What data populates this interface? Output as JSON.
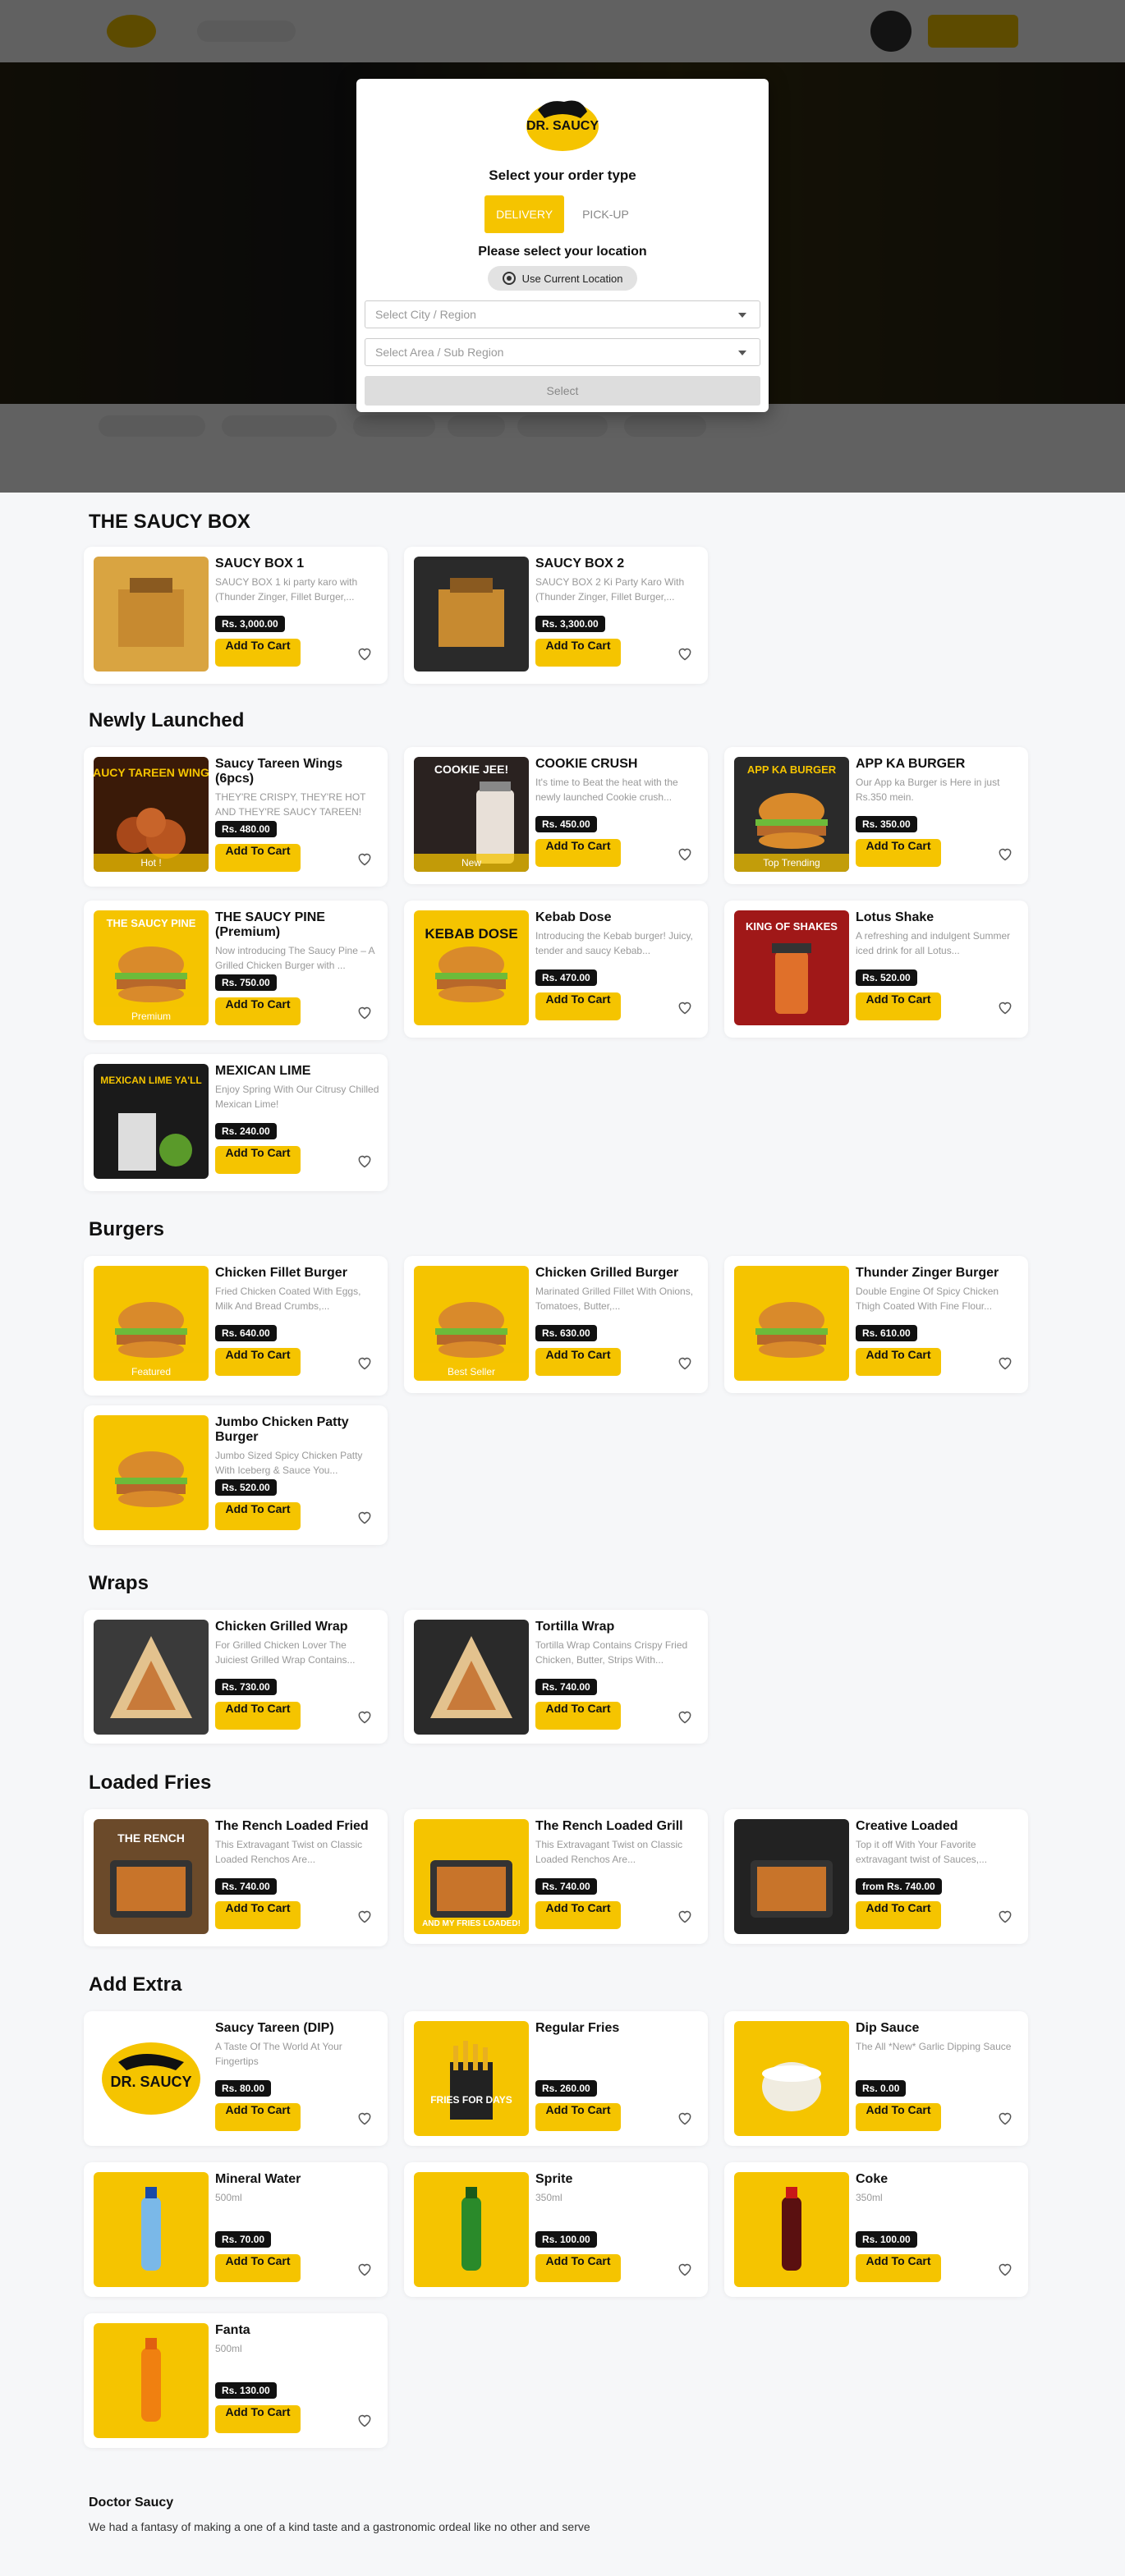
{
  "modal": {
    "title": "Select your order type",
    "delivery": "DELIVERY",
    "pickup": "PICK-UP",
    "location_title": "Please select your location",
    "current_location": "Use Current Location",
    "city_placeholder": "Select City / Region",
    "area_placeholder": "Select Area / Sub Region",
    "select_button": "Select",
    "logo_text": "DR. SAUCY"
  },
  "sections": [
    {
      "title": "THE SAUCY BOX"
    },
    {
      "title": "Newly Launched"
    },
    {
      "title": "Burgers"
    },
    {
      "title": "Wraps"
    },
    {
      "title": "Loaded Fries"
    },
    {
      "title": "Add Extra"
    }
  ],
  "add_to_cart": "Add To Cart",
  "products": [
    {
      "name": "SAUCY BOX 1",
      "desc": "SAUCY BOX 1 ki party karo with (Thunder Zinger, Fillet Burger,...",
      "price": "Rs. 3,000.00"
    },
    {
      "name": "SAUCY BOX 2",
      "desc": "SAUCY BOX 2 Ki Party Karo With (Thunder Zinger, Fillet Burger,...",
      "price": "Rs. 3,300.00"
    },
    {
      "name": "Saucy Tareen Wings (6pcs)",
      "desc": "THEY'RE CRISPY, THEY'RE HOT AND THEY'RE SAUCY TAREEN!",
      "price": "Rs. 480.00",
      "badge": "Hot !"
    },
    {
      "name": "COOKIE CRUSH",
      "desc": "It's time to Beat the heat with the newly launched Cookie crush...",
      "price": "Rs. 450.00",
      "badge": "New"
    },
    {
      "name": "APP KA BURGER",
      "desc": "Our App ka Burger is Here in just Rs.350 mein.",
      "price": "Rs. 350.00",
      "badge": "Top Trending"
    },
    {
      "name": "THE SAUCY PINE (Premium)",
      "desc": "Now introducing The Saucy Pine – A Grilled Chicken Burger with ...",
      "price": "Rs. 750.00",
      "badge": "Premium"
    },
    {
      "name": "Kebab Dose",
      "desc": "Introducing the Kebab burger! Juicy, tender and saucy Kebab...",
      "price": "Rs. 470.00"
    },
    {
      "name": "Lotus Shake",
      "desc": "A refreshing and indulgent Summer iced drink for all Lotus...",
      "price": "Rs. 520.00"
    },
    {
      "name": "MEXICAN LIME",
      "desc": "Enjoy Spring With Our Citrusy Chilled Mexican Lime!",
      "price": "Rs. 240.00"
    },
    {
      "name": "Chicken Fillet Burger",
      "desc": "Fried Chicken Coated With Eggs, Milk And Bread Crumbs,...",
      "price": "Rs. 640.00",
      "badge": "Featured"
    },
    {
      "name": "Chicken Grilled Burger",
      "desc": "Marinated Grilled Fillet With Onions, Tomatoes, Butter,...",
      "price": "Rs. 630.00",
      "badge": "Best Seller"
    },
    {
      "name": "Thunder Zinger Burger",
      "desc": "Double Engine Of Spicy Chicken Thigh Coated With Fine Flour...",
      "price": "Rs. 610.00"
    },
    {
      "name": "Jumbo Chicken Patty Burger",
      "desc": "Jumbo Sized Spicy Chicken Patty With Iceberg & Sauce You...",
      "price": "Rs. 520.00"
    },
    {
      "name": "Chicken Grilled Wrap",
      "desc": "For Grilled Chicken Lover The Juiciest Grilled Wrap Contains...",
      "price": "Rs. 730.00"
    },
    {
      "name": "Tortilla Wrap",
      "desc": "Tortilla Wrap Contains Crispy Fried Chicken, Butter, Strips With...",
      "price": "Rs. 740.00"
    },
    {
      "name": "The Rench Loaded Fried",
      "desc": "This Extravagant Twist on Classic Loaded Renchos Are...",
      "price": "Rs. 740.00"
    },
    {
      "name": "The Rench Loaded Grill",
      "desc": "This Extravagant Twist on Classic Loaded Renchos Are...",
      "price": "Rs. 740.00"
    },
    {
      "name": "Creative Loaded",
      "desc": "Top it off With Your Favorite extravagant twist of Sauces,...",
      "price": "from Rs. 740.00"
    },
    {
      "name": "Saucy Tareen (DIP)",
      "desc": "A Taste Of The World At Your Fingertips",
      "price": "Rs. 80.00"
    },
    {
      "name": "Regular Fries",
      "desc": "",
      "price": "Rs. 260.00"
    },
    {
      "name": "Dip Sauce",
      "desc": "The All *New* Garlic Dipping Sauce",
      "price": "Rs. 0.00"
    },
    {
      "name": "Mineral Water",
      "desc": "500ml",
      "price": "Rs. 70.00"
    },
    {
      "name": "Sprite",
      "desc": "350ml",
      "price": "Rs. 100.00"
    },
    {
      "name": "Coke",
      "desc": "350ml",
      "price": "Rs. 100.00"
    },
    {
      "name": "Fanta",
      "desc": "500ml",
      "price": "Rs. 130.00"
    }
  ],
  "image_text": {
    "wings": "SAUCY TAREEN WINGS",
    "cookie": "COOKIE JEE!",
    "appka": "APP KA BURGER",
    "pine": "THE SAUCY PINE",
    "kebab": "KEBAB DOSE",
    "lotus": "KING OF SHAKES",
    "mexican": "MEXICAN LIME YA'LL",
    "rench": "THE RENCH",
    "loaded": "AND MY FRIES LOADED!",
    "fries": "FRIES FOR DAYS",
    "dip_logo": "DR. SAUCY"
  },
  "footer": {
    "title": "Doctor Saucy",
    "desc": "We had a fantasy of making a one of a kind taste and a gastronomic ordeal like no other and serve"
  },
  "colors": {
    "accent": "#f5c400",
    "price_bg": "#111111"
  }
}
